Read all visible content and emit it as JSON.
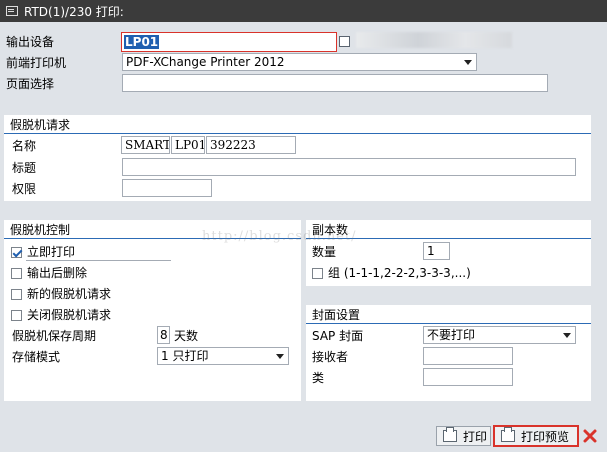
{
  "window": {
    "title": "RTD(1)/230 打印:"
  },
  "top": {
    "output_device_label": "输出设备",
    "output_device_value": "LP01",
    "frontend_printer_label": "前端打印机",
    "frontend_printer_value": "PDF-XChange Printer 2012",
    "page_selection_label": "页面选择",
    "page_selection_value": ""
  },
  "spool_request": {
    "heading": "假脱机请求",
    "name_label": "名称",
    "name_parts": [
      "SMART",
      "LP01",
      "392223"
    ],
    "title_label": "标题",
    "title_value": "",
    "authority_label": "权限",
    "authority_value": ""
  },
  "spool_control": {
    "heading": "假脱机控制",
    "options": [
      {
        "label": "立即打印",
        "checked": true
      },
      {
        "label": "输出后删除",
        "checked": false
      },
      {
        "label": "新的假脱机请求",
        "checked": false
      },
      {
        "label": "关闭假脱机请求",
        "checked": false
      }
    ],
    "retention_label": "假脱机保存周期",
    "retention_value": "8",
    "retention_unit": "天数",
    "storage_mode_label": "存储模式",
    "storage_mode_value": "1 只打印"
  },
  "copies": {
    "heading": "副本数",
    "count_label": "数量",
    "count_value": "1",
    "group_label": "组 (1-1-1,2-2-2,3-3-3,...)",
    "group_checked": false
  },
  "cover": {
    "heading": "封面设置",
    "sap_cover_label": "SAP 封面",
    "sap_cover_value": "不要打印",
    "recipient_label": "接收者",
    "recipient_value": "",
    "department_label": "类",
    "department_value": ""
  },
  "footer": {
    "print_label": "打印",
    "preview_label": "打印预览"
  },
  "watermark": "http://blog.csdn.net/",
  "colors": {
    "accent_line": "#2c6bb5",
    "highlight_border": "#d9332b"
  }
}
